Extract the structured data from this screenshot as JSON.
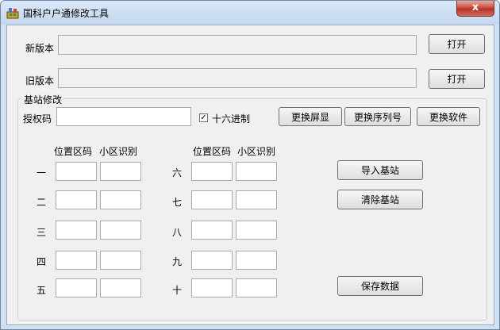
{
  "window": {
    "title": "国科户户通修改工具",
    "close_label": "x"
  },
  "new_version": {
    "label": "新版本",
    "value": "",
    "open_label": "打开"
  },
  "old_version": {
    "label": "旧版本",
    "value": "",
    "open_label": "打开"
  },
  "group": {
    "title": "基站修改"
  },
  "auth": {
    "label": "授权码",
    "value": "",
    "hex_label": "十六进制",
    "hex_checked": "✓"
  },
  "buttons": {
    "change_display": "更换屏显",
    "change_serial": "更换序列号",
    "change_software": "更换软件",
    "import": "导入基站",
    "clear": "清除基站",
    "save": "保存数据"
  },
  "columns": {
    "position_code": "位置区码",
    "cell_id": "小区识别"
  },
  "rows_left": [
    "一",
    "二",
    "三",
    "四",
    "五"
  ],
  "rows_right": [
    "六",
    "七",
    "八",
    "九",
    "十"
  ]
}
